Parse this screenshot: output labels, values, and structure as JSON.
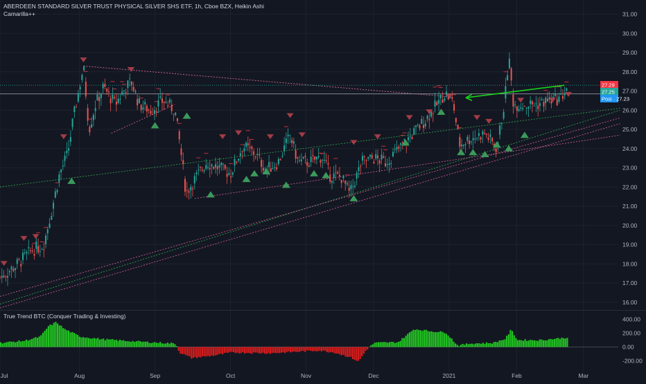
{
  "header": {
    "title": "ABERDEEN STANDARD SILVER TRUST PHYSICAL SILVER SHS ETF, 1h, Cboe BZX, Heikin Ashi",
    "indicator": "Camarilla++"
  },
  "price_tags": [
    {
      "label": "27.29",
      "color": "#f23645"
    },
    {
      "label": "27.25",
      "color": "#26a69a"
    },
    {
      "label": "Posi · 27.23",
      "color": "#2196f3"
    }
  ],
  "colors": {
    "background": "#131722",
    "up": "#26a69a",
    "down": "#ef5350",
    "hist_up": "#22c322",
    "hist_down": "#d41c1c",
    "arrow": "#17d41a"
  },
  "chart_data": [
    {
      "type": "candlestick",
      "title": "ABERDEEN STANDARD SILVER TRUST PHYSICAL SILVER SHS ETF, 1h, Cboe BZX, Heikin Ashi",
      "x_ticks": [
        "Jul",
        "Aug",
        "Sep",
        "Oct",
        "Nov",
        "Dec",
        "2021",
        "Feb",
        "Mar"
      ],
      "y_ticks": [
        "31.00",
        "30.00",
        "29.00",
        "28.00",
        "27.00",
        "26.00",
        "25.00",
        "24.00",
        "23.00",
        "22.00",
        "21.00",
        "20.00",
        "19.00",
        "18.00",
        "17.00",
        "16.00"
      ],
      "ylim": [
        15.7,
        31.6
      ],
      "close_path": [
        [
          0,
          17.3
        ],
        [
          2,
          17.9
        ],
        [
          4,
          18.7
        ],
        [
          5.5,
          19.0
        ],
        [
          6.5,
          20.8
        ],
        [
          7.5,
          22.7
        ],
        [
          8.5,
          23.7
        ],
        [
          9.2,
          25.5
        ],
        [
          10.5,
          28.3
        ],
        [
          11.2,
          25.0
        ],
        [
          12,
          26.3
        ],
        [
          13,
          27.2
        ],
        [
          14.5,
          26.3
        ],
        [
          15.5,
          27.0
        ],
        [
          16.5,
          27.5
        ],
        [
          17.5,
          26.3
        ],
        [
          19,
          26.0
        ],
        [
          20.5,
          26.5
        ],
        [
          22,
          26.0
        ],
        [
          22.7,
          24.0
        ],
        [
          23.4,
          21.7
        ],
        [
          24.5,
          22.4
        ],
        [
          26,
          23.3
        ],
        [
          27.5,
          23.0
        ],
        [
          29,
          22.7
        ],
        [
          30.5,
          24.1
        ],
        [
          32,
          23.8
        ],
        [
          33.5,
          22.9
        ],
        [
          35,
          23.3
        ],
        [
          36.5,
          24.7
        ],
        [
          37.5,
          23.3
        ],
        [
          39,
          23.3
        ],
        [
          40.5,
          23.6
        ],
        [
          41.5,
          22.6
        ],
        [
          43,
          22.5
        ],
        [
          44,
          21.6
        ],
        [
          45.5,
          23.3
        ],
        [
          47,
          23.5
        ],
        [
          48.5,
          23.3
        ],
        [
          50,
          23.9
        ],
        [
          52,
          24.8
        ],
        [
          53.5,
          25.5
        ],
        [
          55,
          26.3
        ],
        [
          56,
          26.9
        ],
        [
          57,
          26.4
        ],
        [
          57.8,
          24.2
        ],
        [
          59,
          24.5
        ],
        [
          61,
          24.8
        ],
        [
          62.5,
          24.0
        ],
        [
          63.5,
          26.5
        ],
        [
          64,
          28.8
        ],
        [
          64.6,
          26.3
        ],
        [
          66,
          26.3
        ],
        [
          67.5,
          26.3
        ],
        [
          69,
          26.5
        ],
        [
          70.5,
          26.6
        ],
        [
          71.5,
          27.3
        ]
      ],
      "pivot_highs": [
        [
          0.5,
          18.0
        ],
        [
          3,
          19.3
        ],
        [
          4.5,
          19.4
        ],
        [
          8,
          24.6
        ],
        [
          10.5,
          28.6
        ],
        [
          16.5,
          28.1
        ],
        [
          28,
          24.6
        ],
        [
          30,
          24.8
        ],
        [
          34,
          24.6
        ],
        [
          36.5,
          25.7
        ],
        [
          38,
          24.7
        ],
        [
          44.5,
          24.3
        ],
        [
          47.5,
          24.6
        ],
        [
          51.5,
          25.6
        ],
        [
          54,
          25.9
        ],
        [
          56.5,
          26.7
        ],
        [
          60,
          25.6
        ],
        [
          61.5,
          25.4
        ],
        [
          65.5,
          26.5
        ],
        [
          69.5,
          26.5
        ],
        [
          71.5,
          26.8
        ]
      ],
      "pivot_lows": [
        [
          9,
          22.3
        ],
        [
          19.5,
          25.2
        ],
        [
          23.5,
          25.7
        ],
        [
          26.5,
          21.6
        ],
        [
          31,
          22.4
        ],
        [
          32,
          22.7
        ],
        [
          33.5,
          22.8
        ],
        [
          36,
          22.1
        ],
        [
          39.5,
          22.7
        ],
        [
          41,
          22.6
        ],
        [
          44.5,
          21.4
        ],
        [
          51,
          24.3
        ],
        [
          55.5,
          25.9
        ],
        [
          58,
          23.8
        ],
        [
          59.5,
          23.8
        ],
        [
          61,
          23.7
        ],
        [
          62.5,
          24.2
        ],
        [
          64,
          24.0
        ],
        [
          66,
          24.7
        ]
      ],
      "current_price": 27.29
    },
    {
      "type": "bar",
      "title": "True Trend BTC (Conquer Trading & Investing)",
      "y_ticks": [
        "400.00",
        "200.00",
        "0.00",
        "-200.00"
      ],
      "ylim": [
        -240,
        430
      ],
      "profile": [
        [
          0,
          60
        ],
        [
          3,
          90
        ],
        [
          5,
          150
        ],
        [
          6,
          300
        ],
        [
          7,
          360
        ],
        [
          8,
          260
        ],
        [
          10,
          150
        ],
        [
          13,
          110
        ],
        [
          17,
          80
        ],
        [
          22,
          50
        ],
        [
          22.5,
          -80
        ],
        [
          24,
          -160
        ],
        [
          27,
          -120
        ],
        [
          29,
          -80
        ],
        [
          34,
          -90
        ],
        [
          40,
          -50
        ],
        [
          42,
          -80
        ],
        [
          44,
          -150
        ],
        [
          45,
          -210
        ],
        [
          46,
          -40
        ],
        [
          47,
          60
        ],
        [
          50,
          70
        ],
        [
          52,
          260
        ],
        [
          54,
          230
        ],
        [
          56,
          210
        ],
        [
          57.5,
          20
        ],
        [
          59,
          50
        ],
        [
          62,
          60
        ],
        [
          63.5,
          120
        ],
        [
          64.2,
          250
        ],
        [
          65,
          100
        ],
        [
          68,
          100
        ],
        [
          71.5,
          140
        ]
      ]
    }
  ]
}
